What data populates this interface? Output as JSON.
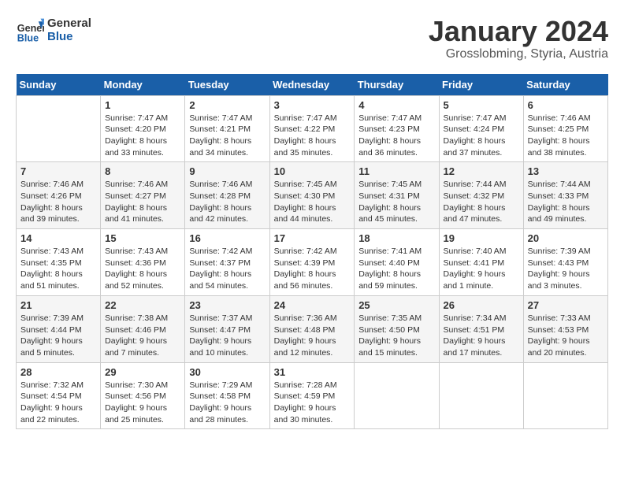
{
  "logo": {
    "text_general": "General",
    "text_blue": "Blue"
  },
  "title": "January 2024",
  "location": "Grosslobming, Styria, Austria",
  "days_of_week": [
    "Sunday",
    "Monday",
    "Tuesday",
    "Wednesday",
    "Thursday",
    "Friday",
    "Saturday"
  ],
  "weeks": [
    [
      {
        "day": "",
        "info": ""
      },
      {
        "day": "1",
        "info": "Sunrise: 7:47 AM\nSunset: 4:20 PM\nDaylight: 8 hours\nand 33 minutes."
      },
      {
        "day": "2",
        "info": "Sunrise: 7:47 AM\nSunset: 4:21 PM\nDaylight: 8 hours\nand 34 minutes."
      },
      {
        "day": "3",
        "info": "Sunrise: 7:47 AM\nSunset: 4:22 PM\nDaylight: 8 hours\nand 35 minutes."
      },
      {
        "day": "4",
        "info": "Sunrise: 7:47 AM\nSunset: 4:23 PM\nDaylight: 8 hours\nand 36 minutes."
      },
      {
        "day": "5",
        "info": "Sunrise: 7:47 AM\nSunset: 4:24 PM\nDaylight: 8 hours\nand 37 minutes."
      },
      {
        "day": "6",
        "info": "Sunrise: 7:46 AM\nSunset: 4:25 PM\nDaylight: 8 hours\nand 38 minutes."
      }
    ],
    [
      {
        "day": "7",
        "info": "Sunrise: 7:46 AM\nSunset: 4:26 PM\nDaylight: 8 hours\nand 39 minutes."
      },
      {
        "day": "8",
        "info": "Sunrise: 7:46 AM\nSunset: 4:27 PM\nDaylight: 8 hours\nand 41 minutes."
      },
      {
        "day": "9",
        "info": "Sunrise: 7:46 AM\nSunset: 4:28 PM\nDaylight: 8 hours\nand 42 minutes."
      },
      {
        "day": "10",
        "info": "Sunrise: 7:45 AM\nSunset: 4:30 PM\nDaylight: 8 hours\nand 44 minutes."
      },
      {
        "day": "11",
        "info": "Sunrise: 7:45 AM\nSunset: 4:31 PM\nDaylight: 8 hours\nand 45 minutes."
      },
      {
        "day": "12",
        "info": "Sunrise: 7:44 AM\nSunset: 4:32 PM\nDaylight: 8 hours\nand 47 minutes."
      },
      {
        "day": "13",
        "info": "Sunrise: 7:44 AM\nSunset: 4:33 PM\nDaylight: 8 hours\nand 49 minutes."
      }
    ],
    [
      {
        "day": "14",
        "info": "Sunrise: 7:43 AM\nSunset: 4:35 PM\nDaylight: 8 hours\nand 51 minutes."
      },
      {
        "day": "15",
        "info": "Sunrise: 7:43 AM\nSunset: 4:36 PM\nDaylight: 8 hours\nand 52 minutes."
      },
      {
        "day": "16",
        "info": "Sunrise: 7:42 AM\nSunset: 4:37 PM\nDaylight: 8 hours\nand 54 minutes."
      },
      {
        "day": "17",
        "info": "Sunrise: 7:42 AM\nSunset: 4:39 PM\nDaylight: 8 hours\nand 56 minutes."
      },
      {
        "day": "18",
        "info": "Sunrise: 7:41 AM\nSunset: 4:40 PM\nDaylight: 8 hours\nand 59 minutes."
      },
      {
        "day": "19",
        "info": "Sunrise: 7:40 AM\nSunset: 4:41 PM\nDaylight: 9 hours\nand 1 minute."
      },
      {
        "day": "20",
        "info": "Sunrise: 7:39 AM\nSunset: 4:43 PM\nDaylight: 9 hours\nand 3 minutes."
      }
    ],
    [
      {
        "day": "21",
        "info": "Sunrise: 7:39 AM\nSunset: 4:44 PM\nDaylight: 9 hours\nand 5 minutes."
      },
      {
        "day": "22",
        "info": "Sunrise: 7:38 AM\nSunset: 4:46 PM\nDaylight: 9 hours\nand 7 minutes."
      },
      {
        "day": "23",
        "info": "Sunrise: 7:37 AM\nSunset: 4:47 PM\nDaylight: 9 hours\nand 10 minutes."
      },
      {
        "day": "24",
        "info": "Sunrise: 7:36 AM\nSunset: 4:48 PM\nDaylight: 9 hours\nand 12 minutes."
      },
      {
        "day": "25",
        "info": "Sunrise: 7:35 AM\nSunset: 4:50 PM\nDaylight: 9 hours\nand 15 minutes."
      },
      {
        "day": "26",
        "info": "Sunrise: 7:34 AM\nSunset: 4:51 PM\nDaylight: 9 hours\nand 17 minutes."
      },
      {
        "day": "27",
        "info": "Sunrise: 7:33 AM\nSunset: 4:53 PM\nDaylight: 9 hours\nand 20 minutes."
      }
    ],
    [
      {
        "day": "28",
        "info": "Sunrise: 7:32 AM\nSunset: 4:54 PM\nDaylight: 9 hours\nand 22 minutes."
      },
      {
        "day": "29",
        "info": "Sunrise: 7:30 AM\nSunset: 4:56 PM\nDaylight: 9 hours\nand 25 minutes."
      },
      {
        "day": "30",
        "info": "Sunrise: 7:29 AM\nSunset: 4:58 PM\nDaylight: 9 hours\nand 28 minutes."
      },
      {
        "day": "31",
        "info": "Sunrise: 7:28 AM\nSunset: 4:59 PM\nDaylight: 9 hours\nand 30 minutes."
      },
      {
        "day": "",
        "info": ""
      },
      {
        "day": "",
        "info": ""
      },
      {
        "day": "",
        "info": ""
      }
    ]
  ]
}
